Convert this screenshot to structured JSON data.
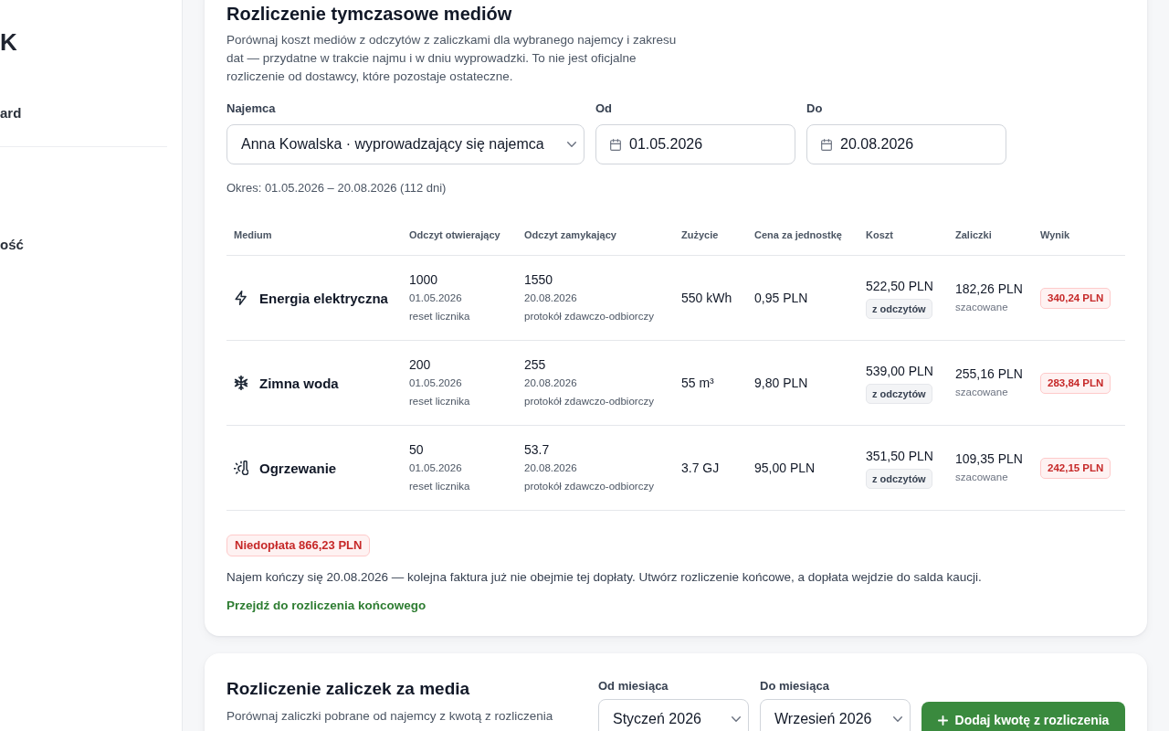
{
  "sidebar": {
    "logo": "K",
    "groups": [
      {
        "items": [
          {
            "label": "ard",
            "selected": false
          }
        ]
      },
      {
        "items": [
          {
            "label": "ość",
            "selected": false
          }
        ]
      }
    ]
  },
  "interim_settlement": {
    "title": "Rozliczenie tymczasowe mediów",
    "description": "Porównaj koszt mediów z odczytów z zaliczkami dla wybranego najemcy i zakresu dat — przydatne w trakcie najmu i w dniu wyprowadzki. To nie jest oficjalne rozliczenie od dostawcy, które pozostaje ostateczne.",
    "filters": [
      {
        "kind": "select",
        "label": "Najemca",
        "value": "Anna Kowalska · wyprowadzający się najemca"
      },
      {
        "kind": "date",
        "label": "Od",
        "value": "01.05.2026"
      },
      {
        "kind": "date",
        "label": "Do",
        "value": "20.08.2026"
      }
    ],
    "period": "Okres: 01.05.2026 – 20.08.2026 (112 dni)",
    "table": {
      "columns": [
        "Medium",
        "Odczyt otwierający",
        "Odczyt zamykający",
        "Zużycie",
        "Cena za jednostkę",
        "Koszt",
        "Zaliczki",
        "Wynik"
      ],
      "rows": [
        {
          "kind": "electricity",
          "medium": "Energia elektryczna",
          "opening": {
            "value": "1000",
            "date": "01.05.2026",
            "note": "reset licznika"
          },
          "closing": {
            "value": "1550",
            "date": "20.08.2026",
            "note": "protokół zdawczo-odbiorczy"
          },
          "usage": "550 kWh",
          "unit_price": "0,95 PLN",
          "cost": "522,50 PLN",
          "cost_source": "z odczytów",
          "advances": "182,26 PLN",
          "advances_note": "szacowane",
          "result": "340,24 PLN"
        },
        {
          "kind": "water",
          "medium": "Zimna woda",
          "opening": {
            "value": "200",
            "date": "01.05.2026",
            "note": "reset licznika"
          },
          "closing": {
            "value": "255",
            "date": "20.08.2026",
            "note": "protokół zdawczo-odbiorczy"
          },
          "usage": "55 m³",
          "unit_price": "9,80 PLN",
          "cost": "539,00 PLN",
          "cost_source": "z odczytów",
          "advances": "255,16 PLN",
          "advances_note": "szacowane",
          "result": "283,84 PLN"
        },
        {
          "kind": "heating",
          "medium": "Ogrzewanie",
          "opening": {
            "value": "50",
            "date": "01.05.2026",
            "note": "reset licznika"
          },
          "closing": {
            "value": "53.7",
            "date": "20.08.2026",
            "note": "protokół zdawczo-odbiorczy"
          },
          "usage": "3.7 GJ",
          "unit_price": "95,00 PLN",
          "cost": "351,50 PLN",
          "cost_source": "z odczytów",
          "advances": "109,35 PLN",
          "advances_note": "szacowane",
          "result": "242,15 PLN"
        }
      ]
    },
    "summary_badge": "Niedopłata 866,23 PLN",
    "note": "Najem kończy się 20.08.2026 — kolejna faktura już nie obejmie tej dopłaty. Utwórz rozliczenie końcowe, a dopłata wejdzie do salda kaucji.",
    "link": "Przejdź do rozliczenia końcowego"
  },
  "advance_settlement": {
    "title": "Rozliczenie zaliczek za media",
    "description": "Porównaj zaliczki pobrane od najemcy z kwotą z rozliczenia",
    "filters": [
      {
        "label": "Od miesiąca",
        "value": "Styczeń 2026"
      },
      {
        "label": "Do miesiąca",
        "value": "Wrzesień 2026"
      }
    ],
    "button": "Dodaj kwotę z rozliczenia"
  }
}
